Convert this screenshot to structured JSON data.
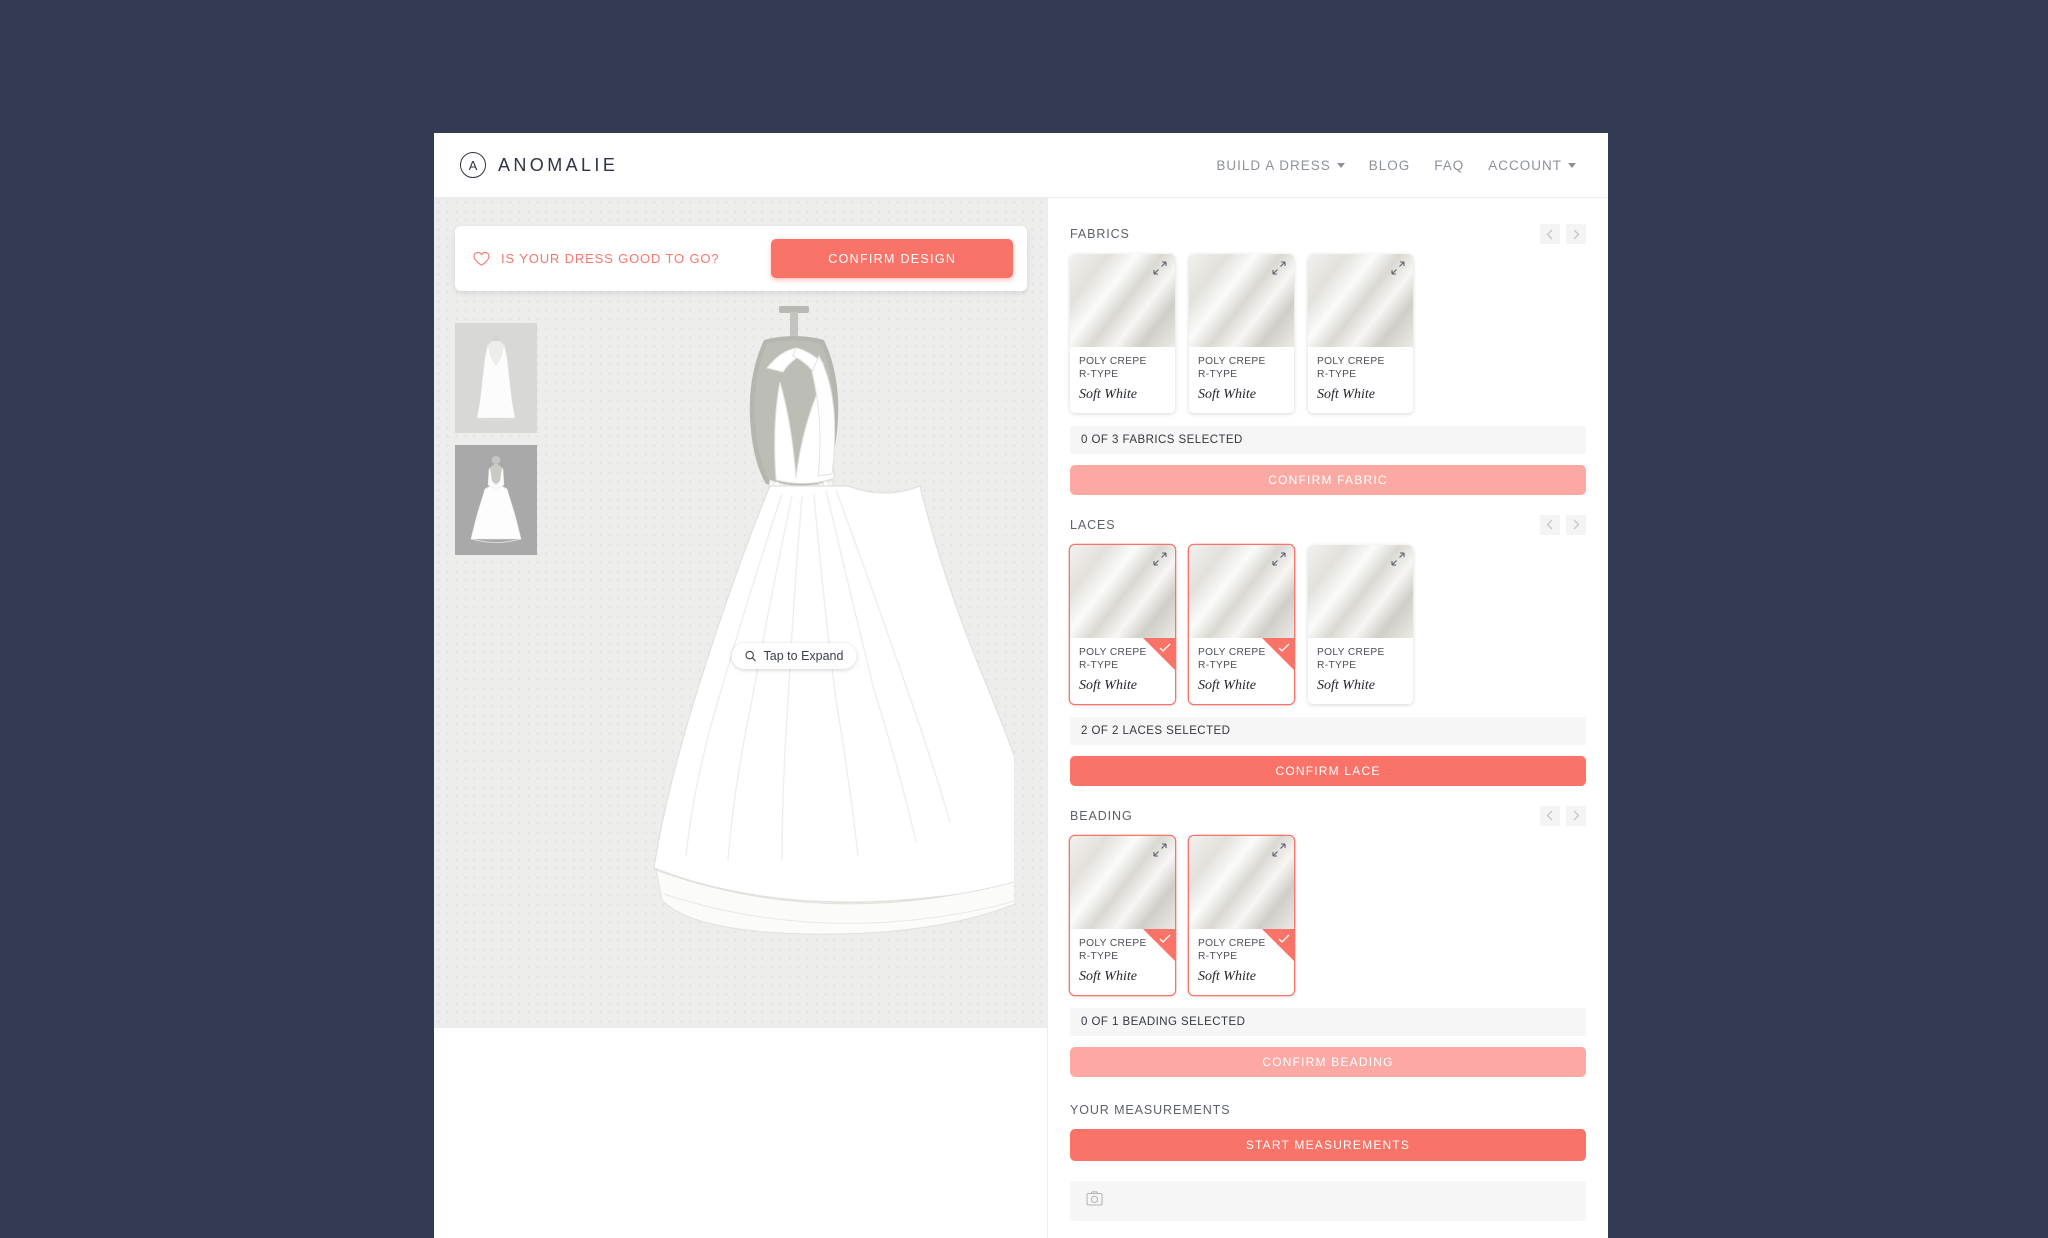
{
  "header": {
    "brand_mark": "A",
    "brand_name": "ANOMALIE",
    "nav": [
      {
        "label": "BUILD A DRESS",
        "has_caret": true
      },
      {
        "label": "BLOG",
        "has_caret": false
      },
      {
        "label": "FAQ",
        "has_caret": false
      },
      {
        "label": "ACCOUNT",
        "has_caret": true
      }
    ]
  },
  "design": {
    "confirm_prompt": "IS YOUR DRESS GOOD TO GO?",
    "confirm_button": "CONFIRM DESIGN",
    "heart_icon": "heart-icon",
    "tap_to_expand": "Tap to Expand",
    "magnifier_icon": "search-icon",
    "thumbnails": [
      {
        "view": "front",
        "selected": false
      },
      {
        "view": "back",
        "selected": true
      }
    ]
  },
  "sections": [
    {
      "key": "fabrics",
      "title": "FABRICS",
      "cards": [
        {
          "type_line1": "POLY CREPE",
          "type_line2": "R-TYPE",
          "color": "Soft White",
          "selected": false
        },
        {
          "type_line1": "POLY CREPE",
          "type_line2": "R-TYPE",
          "color": "Soft White",
          "selected": false
        },
        {
          "type_line1": "POLY CREPE",
          "type_line2": "R-TYPE",
          "color": "Soft White",
          "selected": false
        }
      ],
      "status": "0 OF 3 FABRICS SELECTED",
      "confirm_label": "CONFIRM FABRIC",
      "confirm_enabled": false
    },
    {
      "key": "laces",
      "title": "LACES",
      "cards": [
        {
          "type_line1": "POLY CREPE",
          "type_line2": "R-TYPE",
          "color": "Soft White",
          "selected": true
        },
        {
          "type_line1": "POLY CREPE",
          "type_line2": "R-TYPE",
          "color": "Soft White",
          "selected": true
        },
        {
          "type_line1": "POLY CREPE",
          "type_line2": "R-TYPE",
          "color": "Soft White",
          "selected": false
        }
      ],
      "status": "2 OF 2 LACES SELECTED",
      "confirm_label": "CONFIRM LACE",
      "confirm_enabled": true
    },
    {
      "key": "beading",
      "title": "BEADING",
      "cards": [
        {
          "type_line1": "POLY CREPE",
          "type_line2": "R-TYPE",
          "color": "Soft White",
          "selected": true
        },
        {
          "type_line1": "POLY CREPE",
          "type_line2": "R-TYPE",
          "color": "Soft White",
          "selected": true
        }
      ],
      "status": "0 OF 1 BEADING SELECTED",
      "confirm_label": "CONFIRM BEADING",
      "confirm_enabled": false
    }
  ],
  "measurements": {
    "title": "YOUR MEASUREMENTS",
    "button_label": "START MEASUREMENTS",
    "photo_icon": "photo-icon"
  },
  "colors": {
    "coral": "#fa7368",
    "coral_disabled": "#fca9a3",
    "page_bg": "#333a54",
    "canvas_bg": "#ededec"
  }
}
